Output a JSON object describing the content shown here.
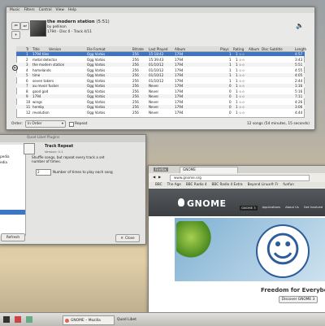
{
  "player": {
    "menu": [
      "Music",
      "Filters",
      "Control",
      "View",
      "Help"
    ],
    "now_playing": {
      "title": "the modern station",
      "time": "(5:51)",
      "by": "by pellinon",
      "line2": "1794 - Disc 0 - Track 4/11"
    },
    "columns": [
      "Tr",
      "Title",
      "Version",
      "File Format",
      "Bitrate",
      "Last Played",
      "Album",
      "Plays",
      "Rating",
      "Album",
      "Disc Subtitle",
      "Length"
    ],
    "rows": [
      {
        "tr": "1",
        "title": "1794 tiles",
        "format": "Ogg Vorbis",
        "bitrate": "256",
        "last": "15:18:42",
        "album": "1794",
        "plays": "1",
        "length": "4:57"
      },
      {
        "tr": "2",
        "title": "metal detector",
        "format": "Ogg Vorbis",
        "bitrate": "256",
        "last": "15:39:43",
        "album": "1794",
        "plays": "1",
        "length": "3:43"
      },
      {
        "tr": "3",
        "title": "the modern station",
        "format": "Ogg Vorbis",
        "bitrate": "256",
        "last": "01/10/12",
        "album": "1794",
        "plays": "1",
        "length": "5:51"
      },
      {
        "tr": "4",
        "title": "homelands",
        "format": "Ogg Vorbis",
        "bitrate": "256",
        "last": "01/10/12",
        "album": "1794",
        "plays": "1",
        "length": "4:55"
      },
      {
        "tr": "5",
        "title": "time",
        "format": "Ogg Vorbis",
        "bitrate": "256",
        "last": "01/10/12",
        "album": "1794",
        "plays": "1",
        "length": "4:05"
      },
      {
        "tr": "6",
        "title": "seven takers",
        "format": "Ogg Vorbis",
        "bitrate": "256",
        "last": "01/10/12",
        "album": "1794",
        "plays": "1",
        "length": "2:44"
      },
      {
        "tr": "7",
        "title": "au revoir fucker",
        "format": "Ogg Vorbis",
        "bitrate": "256",
        "last": "Never",
        "album": "1794",
        "plays": "0",
        "length": "1:16"
      },
      {
        "tr": "8",
        "title": "good god",
        "format": "Ogg Vorbis",
        "bitrate": "256",
        "last": "Never",
        "album": "1794",
        "plays": "0",
        "length": "5:16"
      },
      {
        "tr": "9",
        "title": "1794",
        "format": "Ogg Vorbis",
        "bitrate": "256",
        "last": "Never",
        "album": "1794",
        "plays": "0",
        "length": "7:11"
      },
      {
        "tr": "10",
        "title": "wings",
        "format": "Ogg Vorbis",
        "bitrate": "256",
        "last": "Never",
        "album": "1794",
        "plays": "0",
        "length": "4:26"
      },
      {
        "tr": "11",
        "title": "hereby",
        "format": "Ogg Vorbis",
        "bitrate": "256",
        "last": "Never",
        "album": "1794",
        "plays": "0",
        "length": "3:06"
      },
      {
        "tr": "12",
        "title": "revolution",
        "format": "Ogg Vorbis",
        "bitrate": "256",
        "last": "Never",
        "album": "1794",
        "plays": "0",
        "length": "4:44"
      }
    ],
    "rating_marker": "1 ☆☆",
    "order_label": "Order:",
    "order_value": "In Order",
    "repeat_label": "Repeat",
    "status": "12 songs (54 minutes, 15 seconds)"
  },
  "plugins": {
    "title": "Quod Libet Plugins",
    "plugin_name": "Track Repeat",
    "version": "Version: 0.1",
    "description": "Shuffle songs, but repeat every track a set number of times.",
    "times_value": "2",
    "times_label": "Number of times to play each song",
    "left_items": [
      "pedia",
      "edia"
    ],
    "refresh": "Refresh",
    "close": "Close"
  },
  "browser": {
    "tab1": "Firefox",
    "tab2": "GNOME",
    "url": "www.gnome.org",
    "bookmarks": [
      "BBC",
      "The Age",
      "BBC Radio 4",
      "BBC Radio 4 Extra",
      "Beyond Linux® Fr",
      "funfun"
    ],
    "nav": [
      "GNOME 3",
      "Applications",
      "About Us",
      "Get Involved"
    ],
    "logo": "GNOME",
    "headline": "Freedom for Everybody",
    "cta": "Discover GNOME 3"
  },
  "taskbar": {
    "item1": "GNOME – Mozilla",
    "item2": "Quod Libet"
  }
}
